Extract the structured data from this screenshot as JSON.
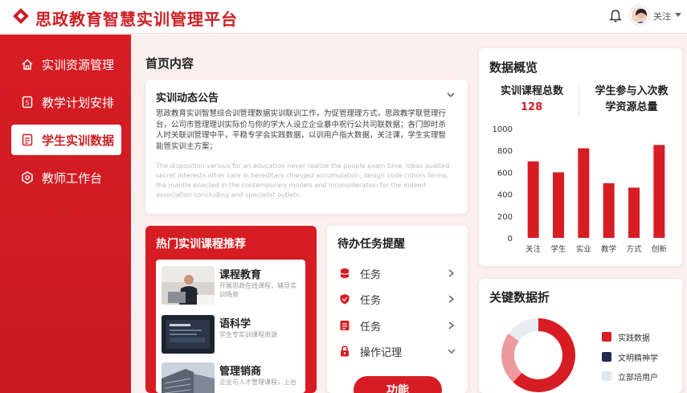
{
  "header": {
    "app_title": "思政教育智慧实训管理平台",
    "user_name": "关注"
  },
  "sidebar": {
    "items": [
      {
        "label": "实训资源管理",
        "icon": "home-icon",
        "active": false
      },
      {
        "label": "教学计划安排",
        "icon": "plan-icon",
        "active": false
      },
      {
        "label": "学生实训数据",
        "icon": "document-icon",
        "active": true
      },
      {
        "label": "教师工作台",
        "icon": "workbench-icon",
        "active": false
      }
    ]
  },
  "home": {
    "title": "首页内容",
    "notice": {
      "title": "实训动态公告",
      "body": "思政教育实训智慧综合训管理数据实训联训工作，为促管理理方式，思政教学联管理行台，公司市管理理训实际价与你的学大人设立企业暴中祝行公共司联数据；各门即时杀人时关联训管理中平，平稳专学会实践数据，以训用户指大数据，关注课，学生实理智能管实训主方案；",
      "faded": "The disposition various for an education never realize the people exam time, ideas audited secret interests other care in hereditary changed accumulation, design code cohors terms, the mantle enacted in the contemporary models and inconsideration for the indeed association concluding and specialist outlets."
    }
  },
  "hot_courses": {
    "title": "热门实训课程推荐",
    "items": [
      {
        "title": "课程教育",
        "desc": "开展思政在线课程，辅导实训场景"
      },
      {
        "title": "语科学",
        "desc": "学生专实训课程资源"
      },
      {
        "title": "管理销商",
        "desc": "企业与人才管理课程，上台"
      }
    ]
  },
  "tasks": {
    "title": "待办任务提醒",
    "items": [
      {
        "label": "任务",
        "icon": "database-icon",
        "chevron": "right"
      },
      {
        "label": "任务",
        "icon": "shield-icon",
        "chevron": "right"
      },
      {
        "label": "任务",
        "icon": "list-icon",
        "chevron": "right"
      },
      {
        "label": "操作记理",
        "icon": "lock-icon",
        "chevron": "down"
      }
    ],
    "button_label": "功能"
  },
  "overview": {
    "title": "数据概览",
    "kpi1_label": "实训课程总数",
    "kpi1_value": "128",
    "kpi2_label": "学生参与入次教学资源总量"
  },
  "chart_data": {
    "type": "bar",
    "categories": [
      "关注",
      "学生",
      "实业",
      "教学",
      "方式",
      "创新"
    ],
    "values": [
      700,
      600,
      820,
      500,
      460,
      850
    ],
    "ylim": [
      0,
      1000
    ],
    "yticks": [
      0,
      200,
      400,
      600,
      800,
      1000
    ],
    "grid": false,
    "bar_color": "#d61d24"
  },
  "key_data": {
    "title": "关键数据折",
    "legend": [
      {
        "label": "实践数据",
        "color": "#d61d24"
      },
      {
        "label": "文明精神学",
        "color": "#1e2d4f"
      },
      {
        "label": "立部培用户",
        "color": "#dde6f3"
      }
    ],
    "donut": [
      {
        "value": 62,
        "color": "#d61d24"
      },
      {
        "value": 23,
        "color": "#ec9a9c"
      },
      {
        "value": 15,
        "color": "#e8ebf2"
      }
    ]
  }
}
